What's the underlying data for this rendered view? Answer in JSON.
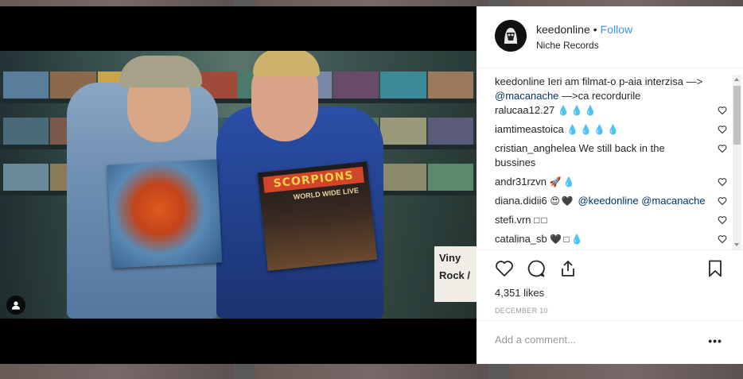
{
  "post": {
    "username": "keedonline",
    "separator": "•",
    "follow_label": "Follow",
    "location": "Niche Records"
  },
  "photo": {
    "album_right_band": "SCORPIONS",
    "album_right_sub": "WORLD WIDE LIVE",
    "sign_text": "Viny Rock /"
  },
  "caption": {
    "user": "keedonline",
    "text_1": " Ieri am filmat-o p-aia interzisa —> ",
    "mention": "@macanache",
    "text_2": " —>ca recordurile"
  },
  "comments": [
    {
      "user": "ralucaa12.27",
      "text": "💧💧💧"
    },
    {
      "user": "iamtimeastoica",
      "text": "💧💧💧💧"
    },
    {
      "user": "cristian_anghelea",
      "text": "We still back in the bussines"
    },
    {
      "user": "andr31rzvn",
      "text": "🚀💧"
    },
    {
      "user": "diana.didii6",
      "text": "😍🖤",
      "mention1": "@keedonline",
      "mention2": "@macanache"
    },
    {
      "user": "stefi.vrn",
      "text": "□□"
    },
    {
      "user": "catalina_sb",
      "text": "🖤□💧"
    }
  ],
  "actions": {
    "likes": "4,351 likes",
    "date": "DECEMBER 10"
  },
  "add_comment": {
    "placeholder": "Add a comment...",
    "more": "•••"
  },
  "colors": {
    "link": "#3897f0",
    "mention": "#003569",
    "text": "#262626",
    "muted": "#999999"
  }
}
